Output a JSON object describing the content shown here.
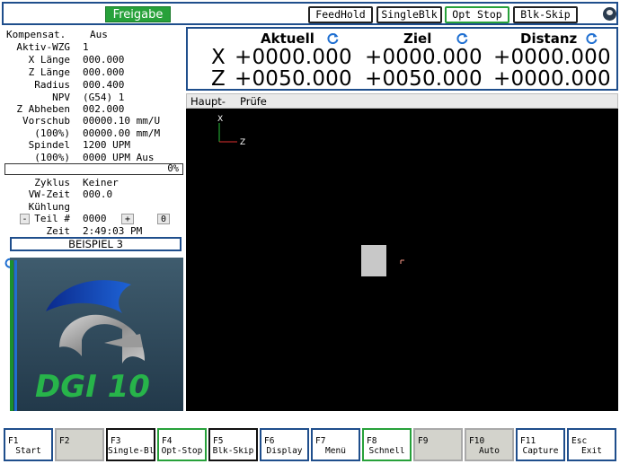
{
  "topbar": {
    "enable_label": "Freigabe",
    "buttons": [
      {
        "label": "FeedHold",
        "style": "black"
      },
      {
        "label": "SingleBlk",
        "style": "black"
      },
      {
        "label": "Opt Stop",
        "style": "green"
      },
      {
        "label": "Blk-Skip",
        "style": "black"
      }
    ],
    "menu_icon": "logo-disc-icon"
  },
  "status": {
    "compensation": {
      "label": "Kompensat.",
      "value": "Aus"
    },
    "active_tool": {
      "label": "Aktiv-WZG",
      "value": "1"
    },
    "x_length": {
      "label": "X Länge",
      "value": "000.000"
    },
    "z_length": {
      "label": "Z Länge",
      "value": "000.000"
    },
    "radius": {
      "label": "Radius",
      "value": "000.400"
    },
    "npv": {
      "label": "NPV",
      "value": "(G54) 1"
    },
    "z_lift": {
      "label": "Z Abheben",
      "value": "002.000"
    },
    "feed": {
      "label": "Vorschub",
      "value": "00000.10 mm/U"
    },
    "feed_override": {
      "label": "(100%)",
      "value": "00000.00 mm/M"
    },
    "spindle": {
      "label": "Spindel",
      "value": "1200 UPM"
    },
    "spindle_override": {
      "label": "(100%)",
      "value": "0000 UPM Aus"
    },
    "progress_percent": 0,
    "progress_label": "0%",
    "cycle": {
      "label": "Zyklus",
      "value": "Keiner"
    },
    "dwell": {
      "label": "VW-Zeit",
      "value": "000.0"
    },
    "cooling": {
      "label": "Kühlung",
      "value": ""
    },
    "part": {
      "label": "Teil #",
      "value": "0000",
      "minus": "-",
      "plus": "+",
      "reset": "0"
    },
    "time": {
      "label": "Zeit",
      "value": "2:49:03 PM"
    },
    "program_name": "BEISPIEL 3"
  },
  "logo": {
    "text": "DGI 10",
    "icon": "dgi-logo-icon"
  },
  "dro": {
    "headers": [
      "Aktuell",
      "Ziel",
      "Distanz"
    ],
    "axes": [
      {
        "axis": "X",
        "values": [
          "+0000.000",
          "+0000.000",
          "+0000.000"
        ]
      },
      {
        "axis": "Z",
        "values": [
          "+0050.000",
          "+0050.000",
          "+0000.000"
        ]
      }
    ]
  },
  "tabs": [
    {
      "label": "Haupt-"
    },
    {
      "label": "Prüfe"
    }
  ],
  "viewport": {
    "axis_x": "X",
    "axis_z": "Z"
  },
  "colors": {
    "accent": "#1f4e8c",
    "green": "#27a13a",
    "canvas": "#000000"
  },
  "fkeys": [
    {
      "code": "F1",
      "label": "Start",
      "style": "blue"
    },
    {
      "code": "F2",
      "label": "",
      "style": "grey"
    },
    {
      "code": "F3",
      "label": "Single-Bl",
      "style": "black"
    },
    {
      "code": "F4",
      "label": "Opt-Stop",
      "style": "green"
    },
    {
      "code": "F5",
      "label": "Blk-Skip",
      "style": "black"
    },
    {
      "code": "F6",
      "label": "Display",
      "style": "blue"
    },
    {
      "code": "F7",
      "label": "Menü",
      "style": "blue"
    },
    {
      "code": "F8",
      "label": "Schnell",
      "style": "green"
    },
    {
      "code": "F9",
      "label": "",
      "style": "grey"
    },
    {
      "code": "F10",
      "label": "Auto",
      "style": "grey"
    },
    {
      "code": "F11",
      "label": "Capture",
      "style": "blue"
    },
    {
      "code": "Esc",
      "label": "Exit",
      "style": "blue"
    }
  ]
}
